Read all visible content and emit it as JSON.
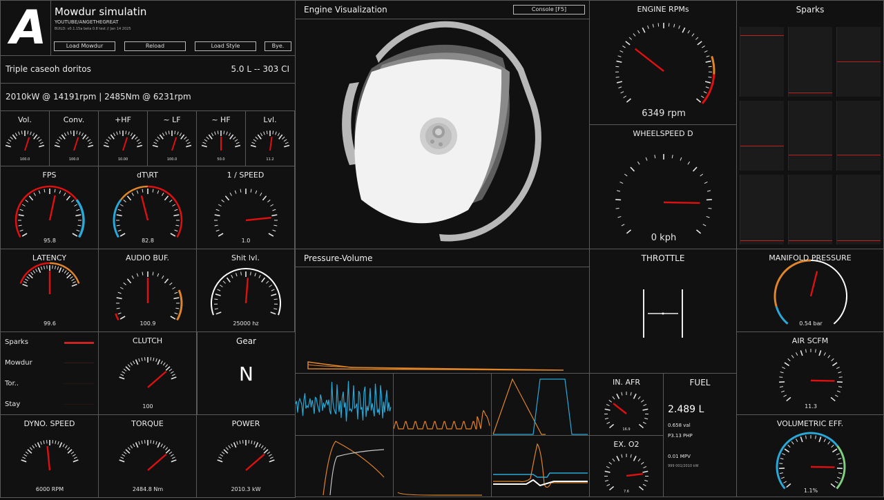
{
  "app": {
    "logo_letter": "A",
    "title": "Mowdur simulatin",
    "subtitle": "YOUTUBE/ANGETHEGREAT",
    "build": "BUILD: v0.1.15a beta 0.8 test // Jan 14 2025",
    "buttons": {
      "load": "Load Mowdur",
      "reload": "Reload",
      "style": "Load Style",
      "bye": "Bye."
    }
  },
  "engine": {
    "name": "Triple caseoh doritos",
    "displacement": "5.0 L -- 303 CI",
    "power_line": "2010kW @ 14191rpm | 2485Nm @ 6231rpm"
  },
  "audio_gauges": [
    {
      "title": "Vol.",
      "value": "100.0",
      "fraction": 0.62
    },
    {
      "title": "Conv.",
      "value": "100.0",
      "fraction": 0.62
    },
    {
      "title": "+HF",
      "value": "10.00",
      "fraction": 0.62
    },
    {
      "title": "~ LF",
      "value": "100.0",
      "fraction": 0.62
    },
    {
      "title": "~ HF",
      "value": "50.0",
      "fraction": 0.5
    },
    {
      "title": "Lvl.",
      "value": "11.2",
      "fraction": 0.55
    }
  ],
  "perf": {
    "fps": {
      "title": "FPS",
      "value": "95.8",
      "fraction": 0.55
    },
    "dtrt": {
      "title": "dT\\RT",
      "value": "82.8",
      "fraction": 0.44
    },
    "speed": {
      "title": "1 / SPEED",
      "value": "1.0",
      "fraction": 0.85
    },
    "latency": {
      "title": "LATENCY",
      "value": "99.6",
      "fraction": 0.5
    },
    "audio_buf": {
      "title": "AUDIO BUF.",
      "value": "100.9",
      "fraction": 0.5
    },
    "shit": {
      "title": "Shit lvl.",
      "value": "25000 hz",
      "fraction": 0.52
    }
  },
  "legend": {
    "items": [
      {
        "label": "Sparks",
        "color": "#cc2222"
      },
      {
        "label": "Mowdur",
        "color": "#3a1a1a"
      },
      {
        "label": "Tor..",
        "color": "#2a1515"
      },
      {
        "label": "Stay",
        "color": "#2a1515"
      }
    ]
  },
  "clutch": {
    "title": "CLUTCH",
    "value": "100",
    "fraction": 0.85
  },
  "gear": {
    "title": "Gear",
    "value": "N"
  },
  "dyno": {
    "speed": {
      "title": "DYNO. SPEED",
      "value": "6000 RPM",
      "fraction": 0.46
    },
    "torque": {
      "title": "TORQUE",
      "value": "2484.8 Nm",
      "fraction": 0.85
    },
    "power": {
      "title": "POWER",
      "value": "2010.3 kW",
      "fraction": 0.85
    }
  },
  "visualization": {
    "title": "Engine Visualization",
    "console": "Console [F5]"
  },
  "rpm": {
    "title": "ENGINE RPMs",
    "value": "6349 rpm",
    "fraction": 0.3
  },
  "wheelspeed": {
    "title": "WHEELSPEED  D",
    "value": "0 kph",
    "fraction": 0.85
  },
  "sparks": {
    "title": "Sparks"
  },
  "pv": {
    "title": "Pressure-Volume"
  },
  "throttle": {
    "title": "THROTTLE"
  },
  "manifold": {
    "title": "MANIFOLD PRESSURE",
    "value": "0.54 bar",
    "fraction": 0.55
  },
  "air": {
    "title": "AIR SCFM",
    "value": "11.3",
    "fraction": 0.85
  },
  "ve": {
    "title": "VOLUMETRIC EFF.",
    "value": "1.1%",
    "fraction": 0.85
  },
  "afr": {
    "title": "IN. AFR",
    "value": "16.9",
    "fraction": 0.3
  },
  "o2": {
    "title": "EX. O2",
    "value": "7.6",
    "fraction": 0.82
  },
  "fuel": {
    "title": "FUEL",
    "amount": "2.489 L",
    "val": "0.658 val",
    "php": "P3.13 PHP",
    "mpv": "0.01 MPV",
    "extra": "999 001/2010 kW"
  },
  "colors": {
    "needle": "#e01010",
    "orange": "#e0852a",
    "blue": "#2aa8d8",
    "green": "#7fd07f"
  }
}
